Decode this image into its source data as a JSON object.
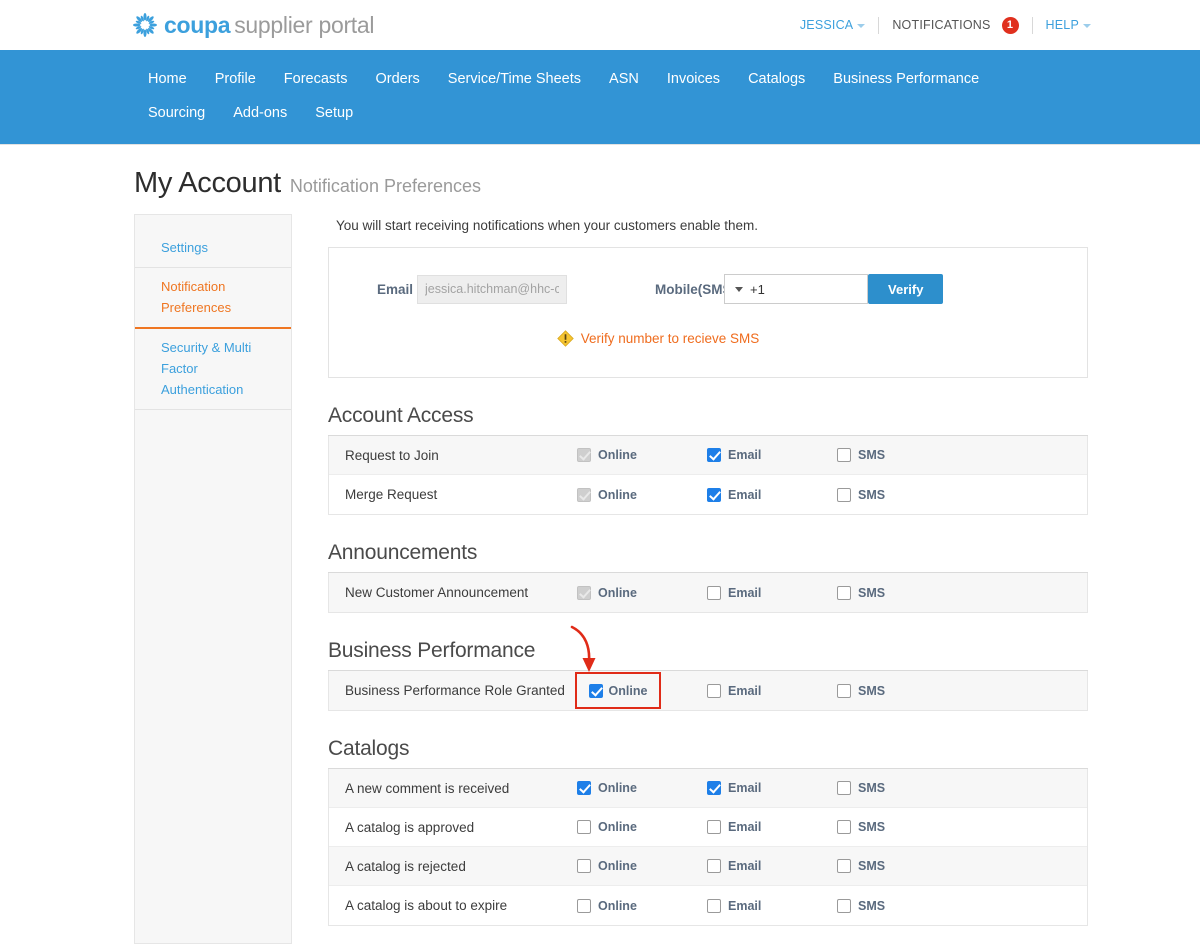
{
  "header": {
    "brand_coupa": "coupa",
    "brand_supplier_portal": "supplier portal",
    "user_name": "JESSICA",
    "notifications_label": "NOTIFICATIONS",
    "notifications_count": "1",
    "help_label": "HELP"
  },
  "nav": {
    "items": [
      {
        "label": "Home"
      },
      {
        "label": "Profile"
      },
      {
        "label": "Forecasts"
      },
      {
        "label": "Orders"
      },
      {
        "label": "Service/Time Sheets"
      },
      {
        "label": "ASN"
      },
      {
        "label": "Invoices"
      },
      {
        "label": "Catalogs"
      },
      {
        "label": "Business Performance"
      },
      {
        "label": "Sourcing"
      },
      {
        "label": "Add-ons"
      },
      {
        "label": "Setup"
      }
    ]
  },
  "page": {
    "title": "My Account",
    "subtitle": "Notification Preferences",
    "intro": "You will start receiving notifications when your customers enable them."
  },
  "sidebar": {
    "items": [
      {
        "label": "Settings",
        "active": false
      },
      {
        "label": "Notification Preferences",
        "active": true
      },
      {
        "label": "Security & Multi Factor Authentication",
        "active": false
      }
    ]
  },
  "contact": {
    "email_label": "Email",
    "email_value": "jessica.hitchman@hhc-cc",
    "mobile_label": "Mobile(SMS)",
    "country_code": "+1",
    "verify_button": "Verify",
    "warning_text": "Verify number to recieve SMS",
    "warning_icon": "warning-diamond-icon"
  },
  "columns": {
    "online": "Online",
    "email": "Email",
    "sms": "SMS"
  },
  "sections": [
    {
      "title": "Account Access",
      "rows": [
        {
          "name": "Request to Join",
          "online": "checked-disabled",
          "email": "checked",
          "sms": "unchecked",
          "highlight": false
        },
        {
          "name": "Merge Request",
          "online": "checked-disabled",
          "email": "checked",
          "sms": "unchecked",
          "highlight": false
        }
      ]
    },
    {
      "title": "Announcements",
      "rows": [
        {
          "name": "New Customer Announcement",
          "online": "checked-disabled",
          "email": "unchecked",
          "sms": "unchecked",
          "highlight": false
        }
      ]
    },
    {
      "title": "Business Performance",
      "rows": [
        {
          "name": "Business Performance Role Granted",
          "online": "checked",
          "email": "unchecked",
          "sms": "unchecked",
          "highlight": true
        }
      ]
    },
    {
      "title": "Catalogs",
      "rows": [
        {
          "name": "A new comment is received",
          "online": "checked",
          "email": "checked",
          "sms": "unchecked",
          "highlight": false
        },
        {
          "name": "A catalog is approved",
          "online": "unchecked",
          "email": "unchecked",
          "sms": "unchecked",
          "highlight": false
        },
        {
          "name": "A catalog is rejected",
          "online": "unchecked",
          "email": "unchecked",
          "sms": "unchecked",
          "highlight": false
        },
        {
          "name": "A catalog is about to expire",
          "online": "unchecked",
          "email": "unchecked",
          "sms": "unchecked",
          "highlight": false
        }
      ]
    }
  ],
  "annotation": {
    "color": "#e02b18",
    "shape": "curved-arrow-pointing-down"
  },
  "colors": {
    "nav_blue": "#3294d5",
    "brand_blue": "#3ca0dd",
    "link_blue": "#3ca0dd",
    "active_orange": "#ef7622",
    "warning_orange": "#ef6c1e",
    "badge_red": "#e0301e",
    "checkbox_blue": "#1e7fe8",
    "annotation_red": "#e02b18"
  }
}
